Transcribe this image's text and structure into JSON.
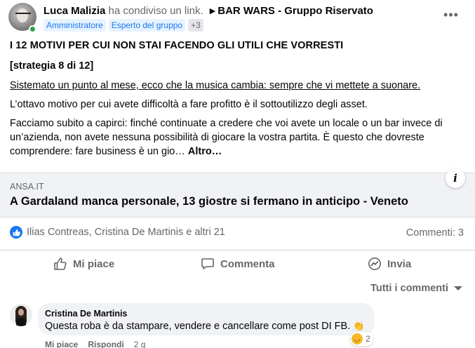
{
  "post": {
    "author": "Luca Malizia",
    "shared_text": "ha condiviso un link.",
    "arrow": "▶",
    "group": "BAR WARS - Gruppo Riservato",
    "badges": [
      "Amministratore",
      "Esperto del gruppo"
    ],
    "more_badges": "+3",
    "menu_icon": "more-dots-icon",
    "lines": {
      "title": "I 12 MOTIVI PER CUI NON STAI FACENDO GLI UTILI CHE VORRESTI",
      "strategy": "[strategia 8 di 12]",
      "subtitle": "Sistemato un punto al mese, ecco che la musica cambia: sempre che vi mettete a suonare.",
      "paragraph1": "L’ottavo motivo per cui avete difficoltà a fare profitto è il sottoutilizzo degli asset.",
      "paragraph2": "Facciamo subito a capirci: finché continuate a credere che voi avete un locale o un bar invece di un’azienda, non avete nessuna possibilità di giocare la vostra partita. È questo che dovreste comprendere: fare business è un gio…",
      "see_more": "Altro…"
    }
  },
  "link_preview": {
    "domain": "ANSA.IT",
    "headline": "A Gardaland manca personale, 13 giostre si fermano in anticipo - Veneto",
    "info": "i"
  },
  "reactions": {
    "names": "Ilias Contreas, Cristina De Martinis e altri 21",
    "comments": "Commenti: 3"
  },
  "actions": {
    "like": "Mi piace",
    "comment": "Commenta",
    "share": "Invia"
  },
  "comments": {
    "sort_label": "Tutti i commenti",
    "items": [
      {
        "author": "Cristina De Martinis",
        "text": "Questa roba è da stampare, vendere e cancellare come post DI FB.",
        "emoji": "👏",
        "reaction_count": "2",
        "like": "Mi piace",
        "reply": "Rispondi",
        "time": "2 g"
      }
    ]
  },
  "colors": {
    "accent": "#1877f2",
    "online": "#31a24c",
    "secondary_text": "#65676b",
    "preview_bg": "#f0f2f5"
  }
}
